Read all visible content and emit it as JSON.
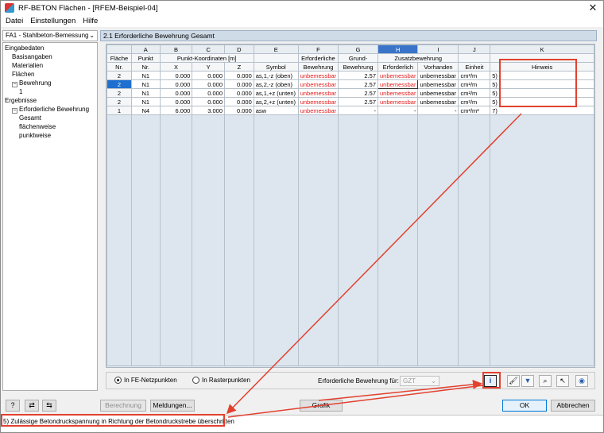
{
  "window": {
    "title": "RF-BETON Flächen - [RFEM-Beispiel-04]"
  },
  "menu": [
    "Datei",
    "Einstellungen",
    "Hilfe"
  ],
  "module_select": {
    "value": "FA1 - Stahlbeton-Bemessung"
  },
  "tree": [
    {
      "label": "Eingabedaten",
      "level": 0,
      "box": ""
    },
    {
      "label": "Basisangaben",
      "level": 1,
      "box": ""
    },
    {
      "label": "Materialien",
      "level": 1,
      "box": ""
    },
    {
      "label": "Flächen",
      "level": 1,
      "box": ""
    },
    {
      "label": "Bewehrung",
      "level": 1,
      "box": "−"
    },
    {
      "label": "1",
      "level": 2,
      "box": ""
    },
    {
      "label": "Ergebnisse",
      "level": 0,
      "box": ""
    },
    {
      "label": "Erforderliche Bewehrung",
      "level": 1,
      "box": "−"
    },
    {
      "label": "Gesamt",
      "level": 2,
      "box": ""
    },
    {
      "label": "flächenweise",
      "level": 2,
      "box": ""
    },
    {
      "label": "punktweise",
      "level": 2,
      "box": ""
    }
  ],
  "panel": {
    "title": "2.1 Erforderliche Bewehrung Gesamt"
  },
  "table": {
    "letters": [
      "A",
      "B",
      "C",
      "D",
      "E",
      "F",
      "G",
      "H",
      "I",
      "J",
      "K"
    ],
    "header1": {
      "flaeche": "Fläche",
      "punkt": "Punkt",
      "koord": "Punkt-Koordinaten [m]",
      "erf": "Erforderliche",
      "grund": "Grund-",
      "zusatz": "Zusatzbewehrung"
    },
    "header2": {
      "flaeche": "Nr.",
      "punkt": "Nr.",
      "x": "X",
      "y": "Y",
      "z": "Z",
      "symbol": "Symbol",
      "erf": "Bewehrung",
      "grund": "Bewehrung",
      "zerf": "Erforderlich",
      "zvorh": "Vorhanden",
      "einheit": "Einheit",
      "hinweis": "Hinweis"
    },
    "rows": [
      {
        "nr": "2",
        "punkt": "N1",
        "x": "0.000",
        "y": "0.000",
        "z": "0.000",
        "symbol": "as,1,-z (oben)",
        "erf": "unbemessbar",
        "grund": "2.57",
        "zerf": "unbemessbar",
        "zvorh": "unbemessbar",
        "einheit": "cm²/m",
        "hinweis": "5)"
      },
      {
        "nr": "2",
        "punkt": "N1",
        "x": "0.000",
        "y": "0.000",
        "z": "0.000",
        "symbol": "as,2,-z (oben)",
        "erf": "unbemessbar",
        "grund": "2.57",
        "zerf": "unbemessbar",
        "zvorh": "unbemessbar",
        "einheit": "cm²/m",
        "hinweis": "5)"
      },
      {
        "nr": "2",
        "punkt": "N1",
        "x": "0.000",
        "y": "0.000",
        "z": "0.000",
        "symbol": "as,1,+z (unten)",
        "erf": "unbemessbar",
        "grund": "2.57",
        "zerf": "unbemessbar",
        "zvorh": "unbemessbar",
        "einheit": "cm²/m",
        "hinweis": "5)"
      },
      {
        "nr": "2",
        "punkt": "N1",
        "x": "0.000",
        "y": "0.000",
        "z": "0.000",
        "symbol": "as,2,+z (unten)",
        "erf": "unbemessbar",
        "grund": "2.57",
        "zerf": "unbemessbar",
        "zvorh": "unbemessbar",
        "einheit": "cm²/m",
        "hinweis": "5)"
      },
      {
        "nr": "1",
        "punkt": "N4",
        "x": "6.000",
        "y": "3.000",
        "z": "0.000",
        "symbol": "asw",
        "erf": "unbemessbar",
        "grund": "-",
        "zerf": "-",
        "zvorh": "-",
        "einheit": "cm²/m²",
        "hinweis": "7)"
      }
    ]
  },
  "options": {
    "radio_fe": "In FE-Netzpunkten",
    "radio_raster": "In Rasterpunkten",
    "label": "Erforderliche Bewehrung für:",
    "select_value": "GZT"
  },
  "buttons": {
    "berechnung": "Berechnung",
    "meldungen": "Meldungen...",
    "grafik": "Grafik",
    "ok": "OK",
    "abbrechen": "Abbrechen"
  },
  "status": {
    "text": "5) Zulässige Betondruckspannung in Richtung der Betondruckstrebe überschritten"
  },
  "colors": {
    "accent": "#1e6fd0",
    "error_text": "#e31b1b",
    "callout": "#e2412f"
  }
}
